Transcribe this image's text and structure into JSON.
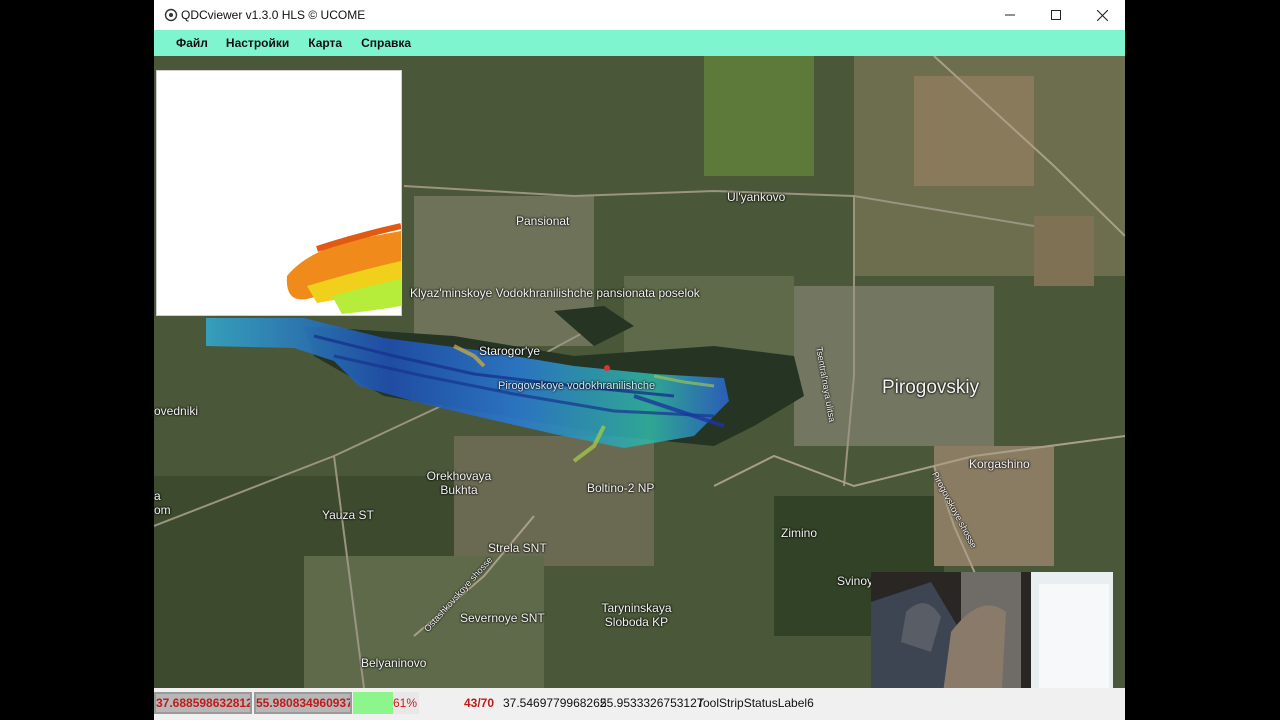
{
  "window": {
    "title": "QDCviewer v1.3.0 HLS ©  UCOME",
    "minimize_icon": "minimize-icon",
    "maximize_icon": "maximize-icon",
    "close_icon": "close-icon"
  },
  "menu": {
    "items": [
      {
        "label": "Файл"
      },
      {
        "label": "Настройки"
      },
      {
        "label": "Карта"
      },
      {
        "label": "Справка"
      }
    ],
    "bg_color": "#7ff5cf"
  },
  "map": {
    "labels": [
      "Pansionat",
      "Ul'yankovo",
      "Klyaz'minskoye Vodokhranilishche pansionata poselok",
      "Starogor'ye",
      "Pirogovskoye vodokhranilishche",
      "Pirogovskiy",
      "Tsentral'naya ulitsa",
      "ovedniki",
      "Orekhovaya Bukhta",
      "Boltino-2 NP",
      "Korgashino",
      "Pirogovskoye shosse",
      "a",
      "om",
      "Yauza ST",
      "Strela SNT",
      "Zimino",
      "Svinoy",
      "Ostashkovskoye shosse",
      "Severnoye SNT",
      "Taryninskaya Sloboda KP",
      "Belyaninovo"
    ]
  },
  "status": {
    "longitude_box": "37.688598632812",
    "latitude_box": "55.980834960937",
    "progress_percent": 61,
    "progress_label": "61%",
    "counter": "43/70",
    "cursor_lon": "37.5469779968262",
    "cursor_lat": "55.9533326753127",
    "extra_label": "ToolStripStatusLabel6"
  }
}
